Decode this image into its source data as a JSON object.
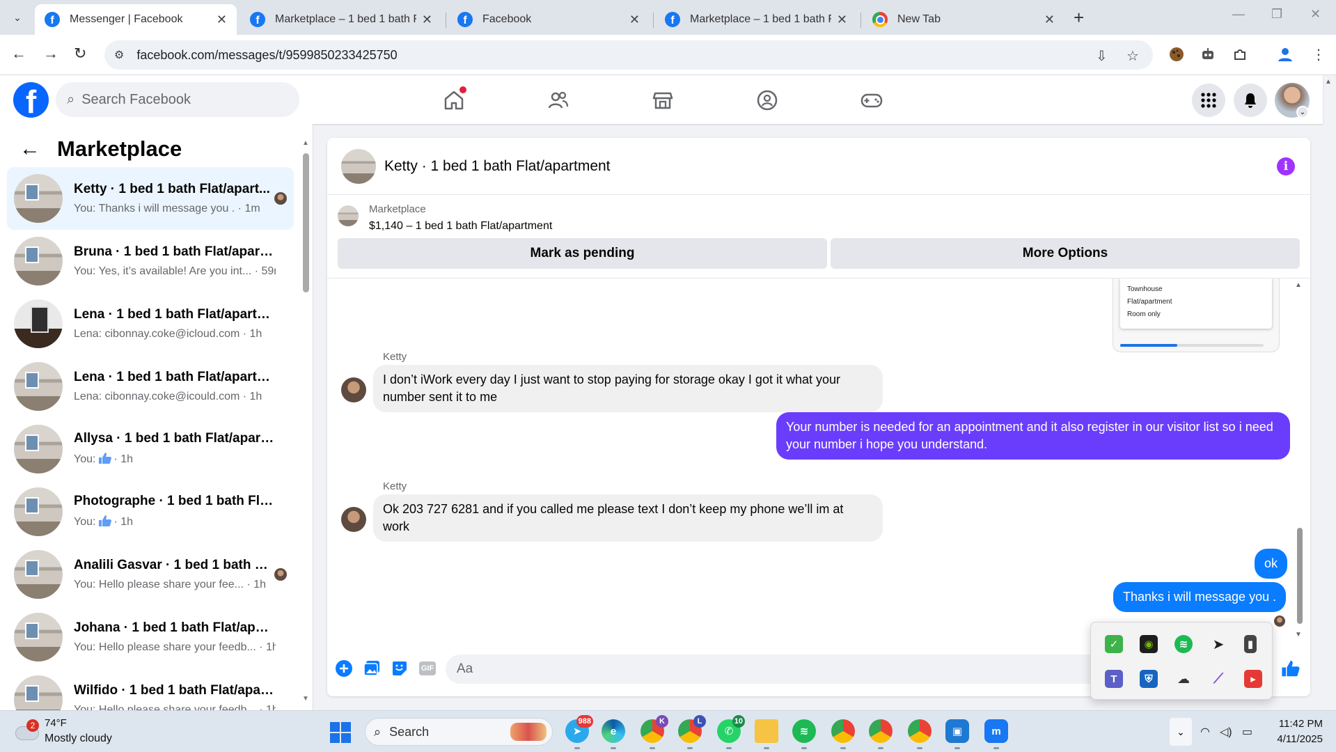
{
  "browser": {
    "tabs": [
      {
        "label": "Messenger | Facebook",
        "icon": "facebook"
      },
      {
        "label": "Marketplace – 1 bed 1 bath Flat/apartment",
        "icon": "facebook"
      },
      {
        "label": "Facebook",
        "icon": "facebook"
      },
      {
        "label": "Marketplace – 1 bed 1 bath Flat/apartment",
        "icon": "facebook"
      },
      {
        "label": "New Tab",
        "icon": "chrome"
      }
    ],
    "url": "facebook.com/messages/t/9599850233425750"
  },
  "fb": {
    "search_placeholder": "Search Facebook"
  },
  "sidebar": {
    "title": "Marketplace",
    "conversations": [
      {
        "name": "Ketty · 1 bed 1 bath Flat/apart...",
        "snippet": "You: Thanks i will message you . · 1m",
        "active": true,
        "read_avatar": true
      },
      {
        "name": "Bruna · 1 bed 1 bath Flat/apartm...",
        "snippet": "You: Yes, it’s available! Are you int... · 59m"
      },
      {
        "name": "Lena · 1 bed 1 bath Flat/apartment",
        "snippet": "Lena: cibonnay.coke@icloud.com · 1h",
        "thumb": "dark"
      },
      {
        "name": "Lena · 1 bed 1 bath Flat/apartment",
        "snippet": "Lena: cibonnay.coke@icould.com · 1h"
      },
      {
        "name": "Allysa · 1 bed 1 bath Flat/apartm...",
        "snippet_prefix": "You:",
        "snippet_suffix": "· 1h",
        "thumbs_up": true
      },
      {
        "name": "Photographe · 1 bed 1 bath Flat/...",
        "snippet_prefix": "You:",
        "snippet_suffix": "· 1h",
        "thumbs_up": true
      },
      {
        "name": "Analili Gasvar · 1 bed 1 bath Fl...",
        "snippet": "You: Hello please share your fee... · 1h",
        "read_avatar": true
      },
      {
        "name": "Johana · 1 bed 1 bath Flat/apart...",
        "snippet": "You: Hello please share your feedb... · 1h"
      },
      {
        "name": "Wilfido · 1 bed 1 bath Flat/apart...",
        "snippet": "You: Hello please share your feedb... · 1h"
      }
    ]
  },
  "chat": {
    "title": "Ketty · 1 bed 1 bath Flat/apartment",
    "listing": {
      "source": "Marketplace",
      "price_line": "$1,140 – 1 bed 1 bath Flat/apartment",
      "pending_label": "Mark as pending",
      "more_label": "More Options"
    },
    "form_preview": {
      "options": [
        "Townhouse",
        "Flat/apartment",
        "Room only"
      ],
      "progress": 0.4
    },
    "messages": [
      {
        "sender": "Ketty",
        "dir": "in",
        "text": "I don’t  iWork every day I just want to stop paying for storage  okay I got it what your number sent it to me"
      },
      {
        "dir": "out",
        "text": "Your number is needed for an appointment and it also register in our visitor list so i need your number i hope you understand."
      },
      {
        "sender": "Ketty",
        "dir": "in",
        "text": "Ok 203 727 6281 and if you called me please text I don’t keep my phone we’ll im at work"
      },
      {
        "dir": "out",
        "text": "ok"
      },
      {
        "dir": "out",
        "text": "Thanks i will message you ."
      }
    ],
    "composer_placeholder": "Aa",
    "gif_label": "GIF"
  },
  "tray_popup": {
    "icons": [
      "shield-check-icon",
      "nvidia-icon",
      "spotify-icon",
      "telegram-icon",
      "usb-drive-icon",
      "teams-icon",
      "defender-warning-icon",
      "onedrive-off-icon",
      "pen-icon",
      "screen-record-icon"
    ]
  },
  "taskbar": {
    "weather_temp": "74°F",
    "weather_desc": "Mostly cloudy",
    "weather_badge": "2",
    "search_label": "Search",
    "telegram_count": "988",
    "chrome_k_badge": "K",
    "chrome_l_badge": "L",
    "whatsapp_count": "10",
    "time": "11:42 PM",
    "date": "4/11/2025"
  },
  "colors": {
    "fb_blue": "#0866ff",
    "outgoing_purple": "#6a3dfd",
    "outgoing_blue": "#0a7cff",
    "active_conv": "#ebf5ff",
    "info_purple": "#a033ff"
  }
}
